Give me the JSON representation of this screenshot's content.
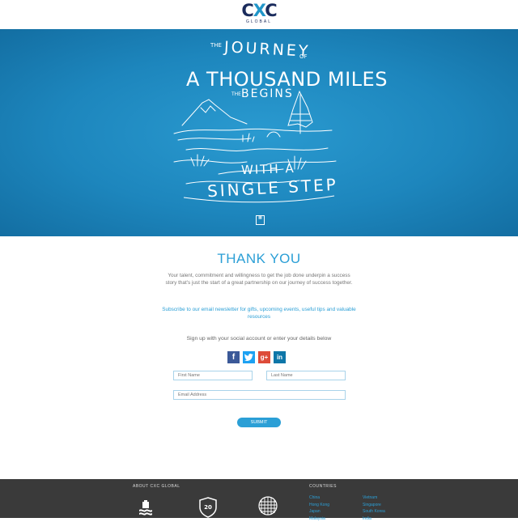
{
  "header": {
    "logo_left": "C",
    "logo_mid": "X",
    "logo_right": "C",
    "logo_sub": "GLOBAL"
  },
  "hero": {
    "the": "THE",
    "journey": "JOURNEY",
    "of": "OF",
    "thousand": "A THOUSAND MILES",
    "the2": "THE",
    "begins": "BEGINS",
    "with_a": "WITH A",
    "single_step": "SINGLE STEP"
  },
  "main": {
    "title": "THANK YOU",
    "paragraph1": "Your talent, commitment and willingness to get the job done underpin a success story that's just the start of a great partnership on our journey of success together.",
    "paragraph2": "Subscribe to our email newsletter for gifts, upcoming events, useful tips and valuable resources",
    "signup_text": "Sign up with your social account or enter your details below",
    "social": {
      "facebook": "f",
      "twitter": "t",
      "googleplus": "g+",
      "linkedin": "in"
    },
    "form": {
      "first_name_placeholder": "First Name",
      "last_name_placeholder": "Last Name",
      "email_placeholder": "Email Address",
      "submit_label": "SUBMIT"
    }
  },
  "footer": {
    "about_heading": "ABOUT CXC GLOBAL",
    "countries_heading": "COUNTRIES",
    "badge_years": "20",
    "countries_col1": [
      "China",
      "Hong Kong",
      "Japan",
      "Malaysia"
    ],
    "countries_col2": [
      "Vietnam",
      "Singapore",
      "South Korea",
      "India"
    ]
  },
  "colors": {
    "accent": "#2b9fd6",
    "navy": "#1a2b5c",
    "hero_blue": "#1d86bd",
    "footer_bg": "#3a3a3a"
  }
}
